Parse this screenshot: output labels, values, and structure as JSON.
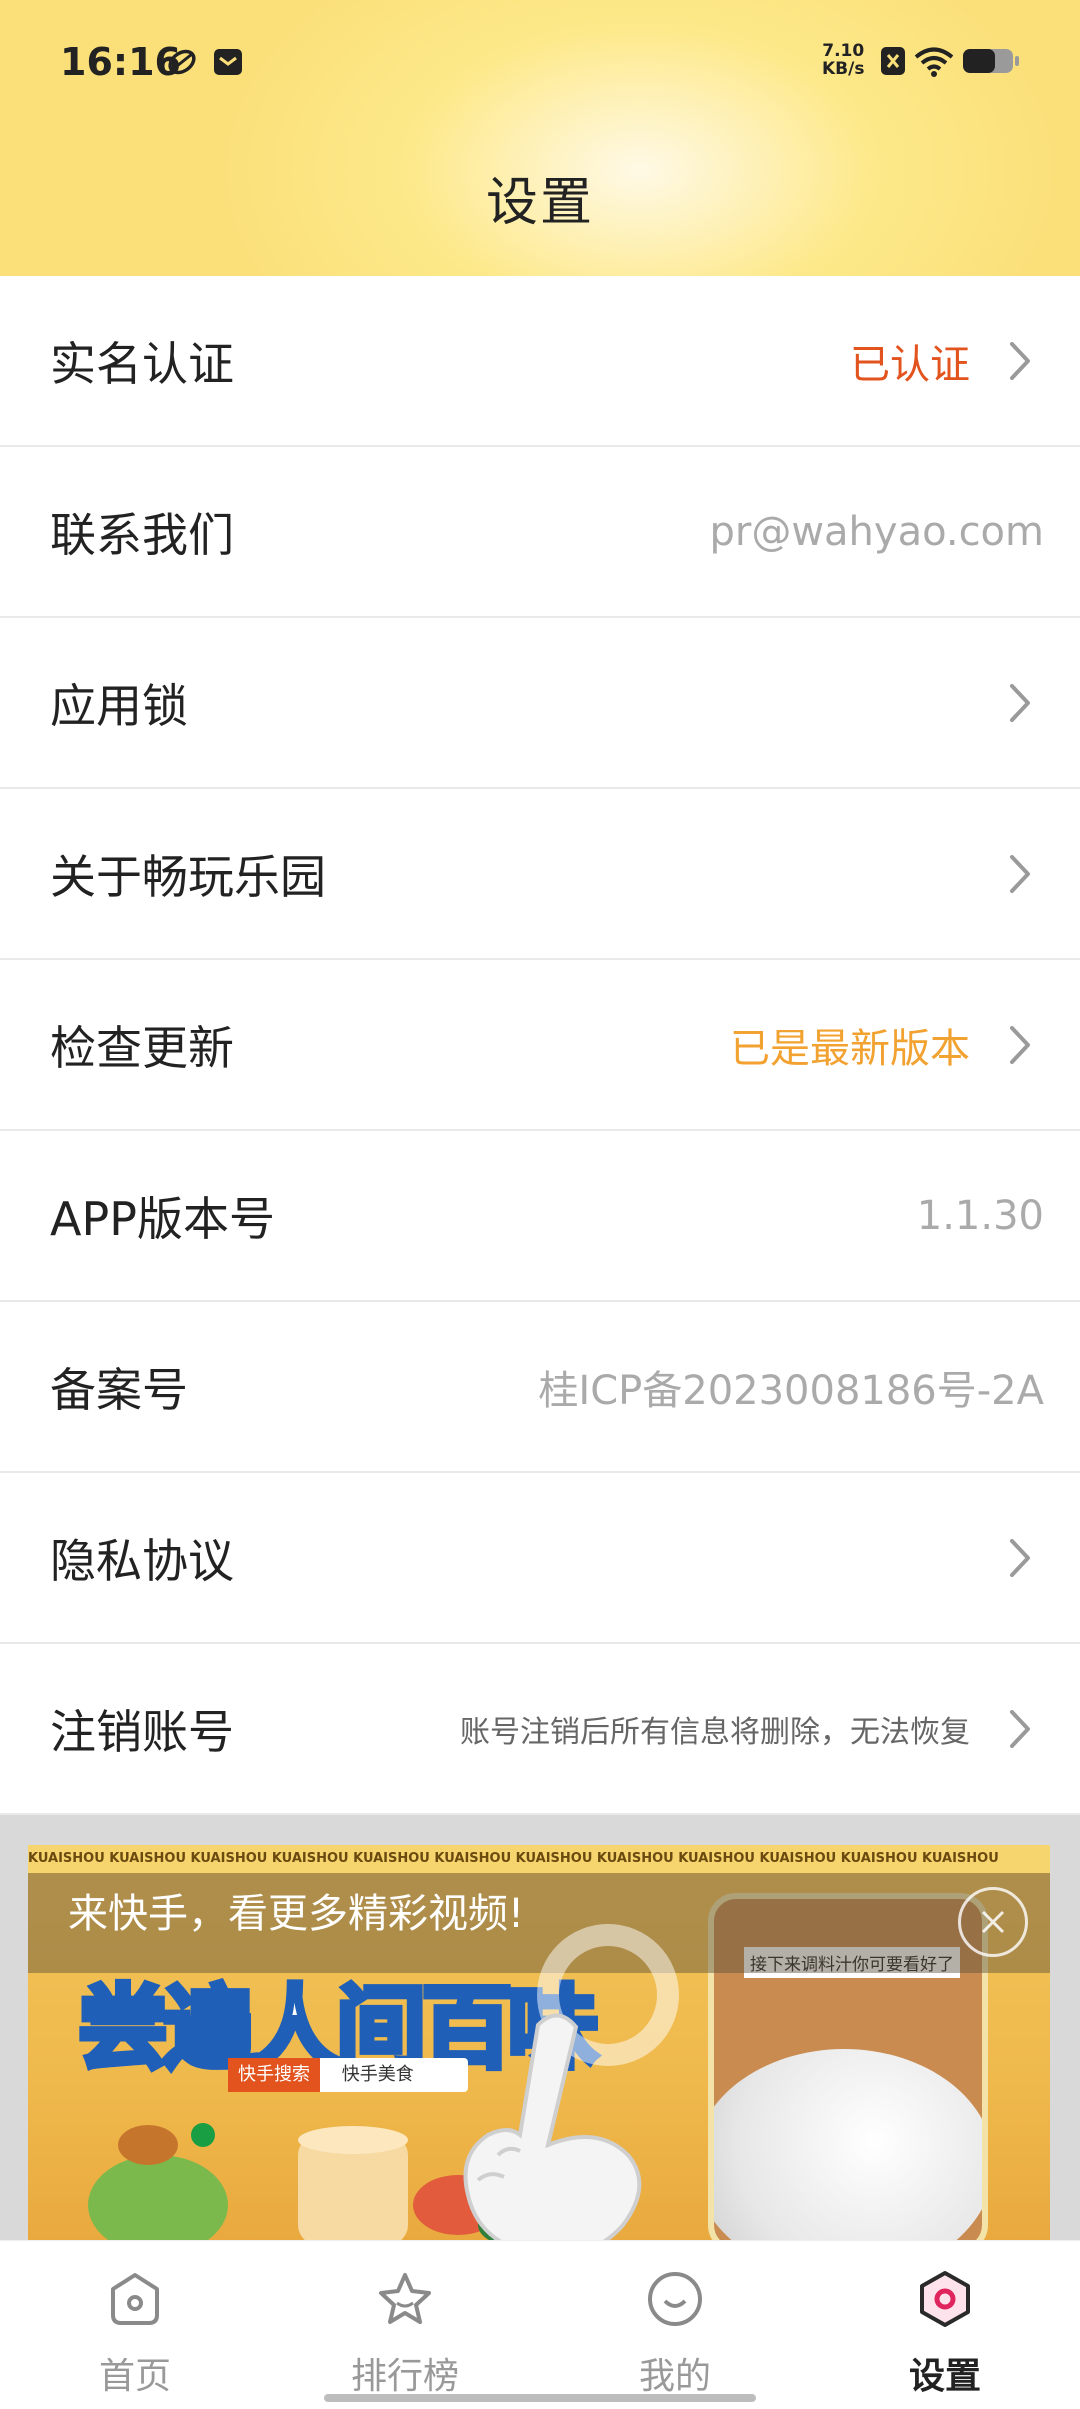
{
  "status_bar": {
    "time": "16:16",
    "speed_value": "7.10",
    "speed_unit": "KB/s"
  },
  "header": {
    "title": "设置"
  },
  "settings": [
    {
      "label": "实名认证",
      "value": "已认证",
      "value_color": "#e2531e",
      "has_arrow": true
    },
    {
      "label": "联系我们",
      "value": "pr@wahyao.com",
      "has_arrow": false
    },
    {
      "label": "应用锁",
      "value": "",
      "has_arrow": true
    },
    {
      "label": "关于畅玩乐园",
      "value": "",
      "has_arrow": true
    },
    {
      "label": "检查更新",
      "value": "已是最新版本",
      "value_color": "#f2a231",
      "has_arrow": true
    },
    {
      "label": "APP版本号",
      "value": "1.1.30",
      "has_arrow": false
    },
    {
      "label": "备案号",
      "value": "桂ICP备2023008186号-2A",
      "has_arrow": false
    },
    {
      "label": "隐私协议",
      "value": "",
      "has_arrow": true
    },
    {
      "label": "注销账号",
      "value": "账号注销后所有信息将删除，无法恢复",
      "has_arrow": true
    }
  ],
  "ad": {
    "ticker": "KUAISHOU KUAISHOU KUAISHOU KUAISHOU KUAISHOU KUAISHOU KUAISHOU KUAISHOU KUAISHOU KUAISHOU KUAISHOU KUAISHOU",
    "caption": "来快手，看更多精彩视频!",
    "headline": "尝遍人间百味",
    "search_tag": "快手搜索",
    "search_text": "快手美食",
    "phone_caption": "接下来调料汁你可要看好了"
  },
  "bottom_nav": [
    {
      "label": "首页",
      "icon": "home-icon",
      "active": false
    },
    {
      "label": "排行榜",
      "icon": "star-icon",
      "active": false
    },
    {
      "label": "我的",
      "icon": "smiley-icon",
      "active": false
    },
    {
      "label": "设置",
      "icon": "settings-hexagon-icon",
      "active": true
    }
  ],
  "colors": {
    "header_yellow": "#fbe07a",
    "accent_red": "#e2531e",
    "accent_orange": "#f2a231",
    "active_nav": "#e0245e"
  }
}
